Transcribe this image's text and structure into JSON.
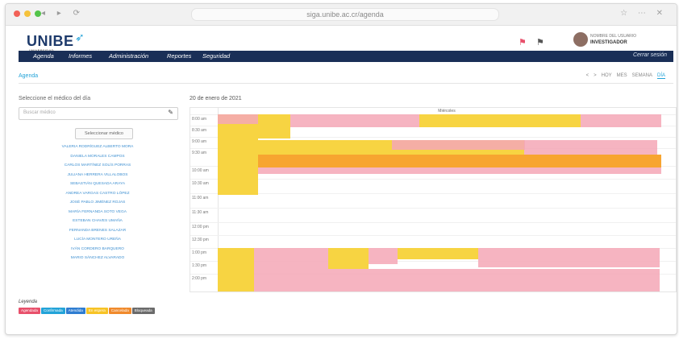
{
  "browser": {
    "url": "siga.unibe.ac.cr/agenda"
  },
  "header": {
    "logo": "UNIBE",
    "logo_tagline": "UNIVERSIDAD IBEROAMERICANA",
    "user_name": "NOMBRE DEL USUARIO",
    "user_role": "INVESTIGADOR"
  },
  "navbar": {
    "items": [
      "Agenda",
      "Informes",
      "Administración",
      "Reportes",
      "Seguridad"
    ],
    "right": "Cerrar sesión"
  },
  "breadcrumb": "Agenda",
  "view_tabs": [
    "<",
    ">",
    "HOY",
    "MES",
    "SEMANA",
    "DÍA"
  ],
  "left_panel": {
    "title": "Seleccione el médico del día",
    "search_placeholder": "Buscar médico",
    "button_label": "Seleccionar médico",
    "doctors": [
      "VALERIA RODRÍGUEZ ALBERTO MORA",
      "DANIELA MORALES CAMPOS",
      "CARLOS MARTÍNEZ SOLÍS PORRAS",
      "JULIANA HERRERA VILLALOBOS",
      "SEBASTIÁN QUESADA ARAYA",
      "ANDREA VARGAS CASTRO LÓPEZ",
      "JOSÉ PABLO JIMÉNEZ ROJAS",
      "MARÍA FERNANDA SOTO VEGA",
      "ESTEBAN CHAVES UMAÑA",
      "FERNANDA BRENES SALAZAR",
      "LUCÍA MONTERO UREÑA",
      "IVÁN CORDERO BARQUERO",
      "MARIO SÁNCHEZ ALVARADO"
    ]
  },
  "calendar": {
    "title": "20 de enero de 2021",
    "day_header": "Miércoles",
    "time_slots": [
      "8:00 am",
      "8:30 am",
      "9:00 am",
      "9:30 am",
      "10:00 am",
      "10:30 am",
      "11:00 am",
      "11:30 am",
      "12:00 pm",
      "12:30 pm",
      "1:00 pm",
      "1:30 pm",
      "2:00 pm",
      "2:30 pm"
    ]
  },
  "legend": {
    "title": "Leyenda",
    "items": [
      {
        "label": "Agendada",
        "color": "#e8506b"
      },
      {
        "label": "Confirmada",
        "color": "#23a3d8"
      },
      {
        "label": "Atendida",
        "color": "#2f7dd1"
      },
      {
        "label": "En espera",
        "color": "#f7c325"
      },
      {
        "label": "Cancelada",
        "color": "#f08a2c"
      },
      {
        "label": "Bloqueada",
        "color": "#6b6b6b"
      }
    ]
  }
}
